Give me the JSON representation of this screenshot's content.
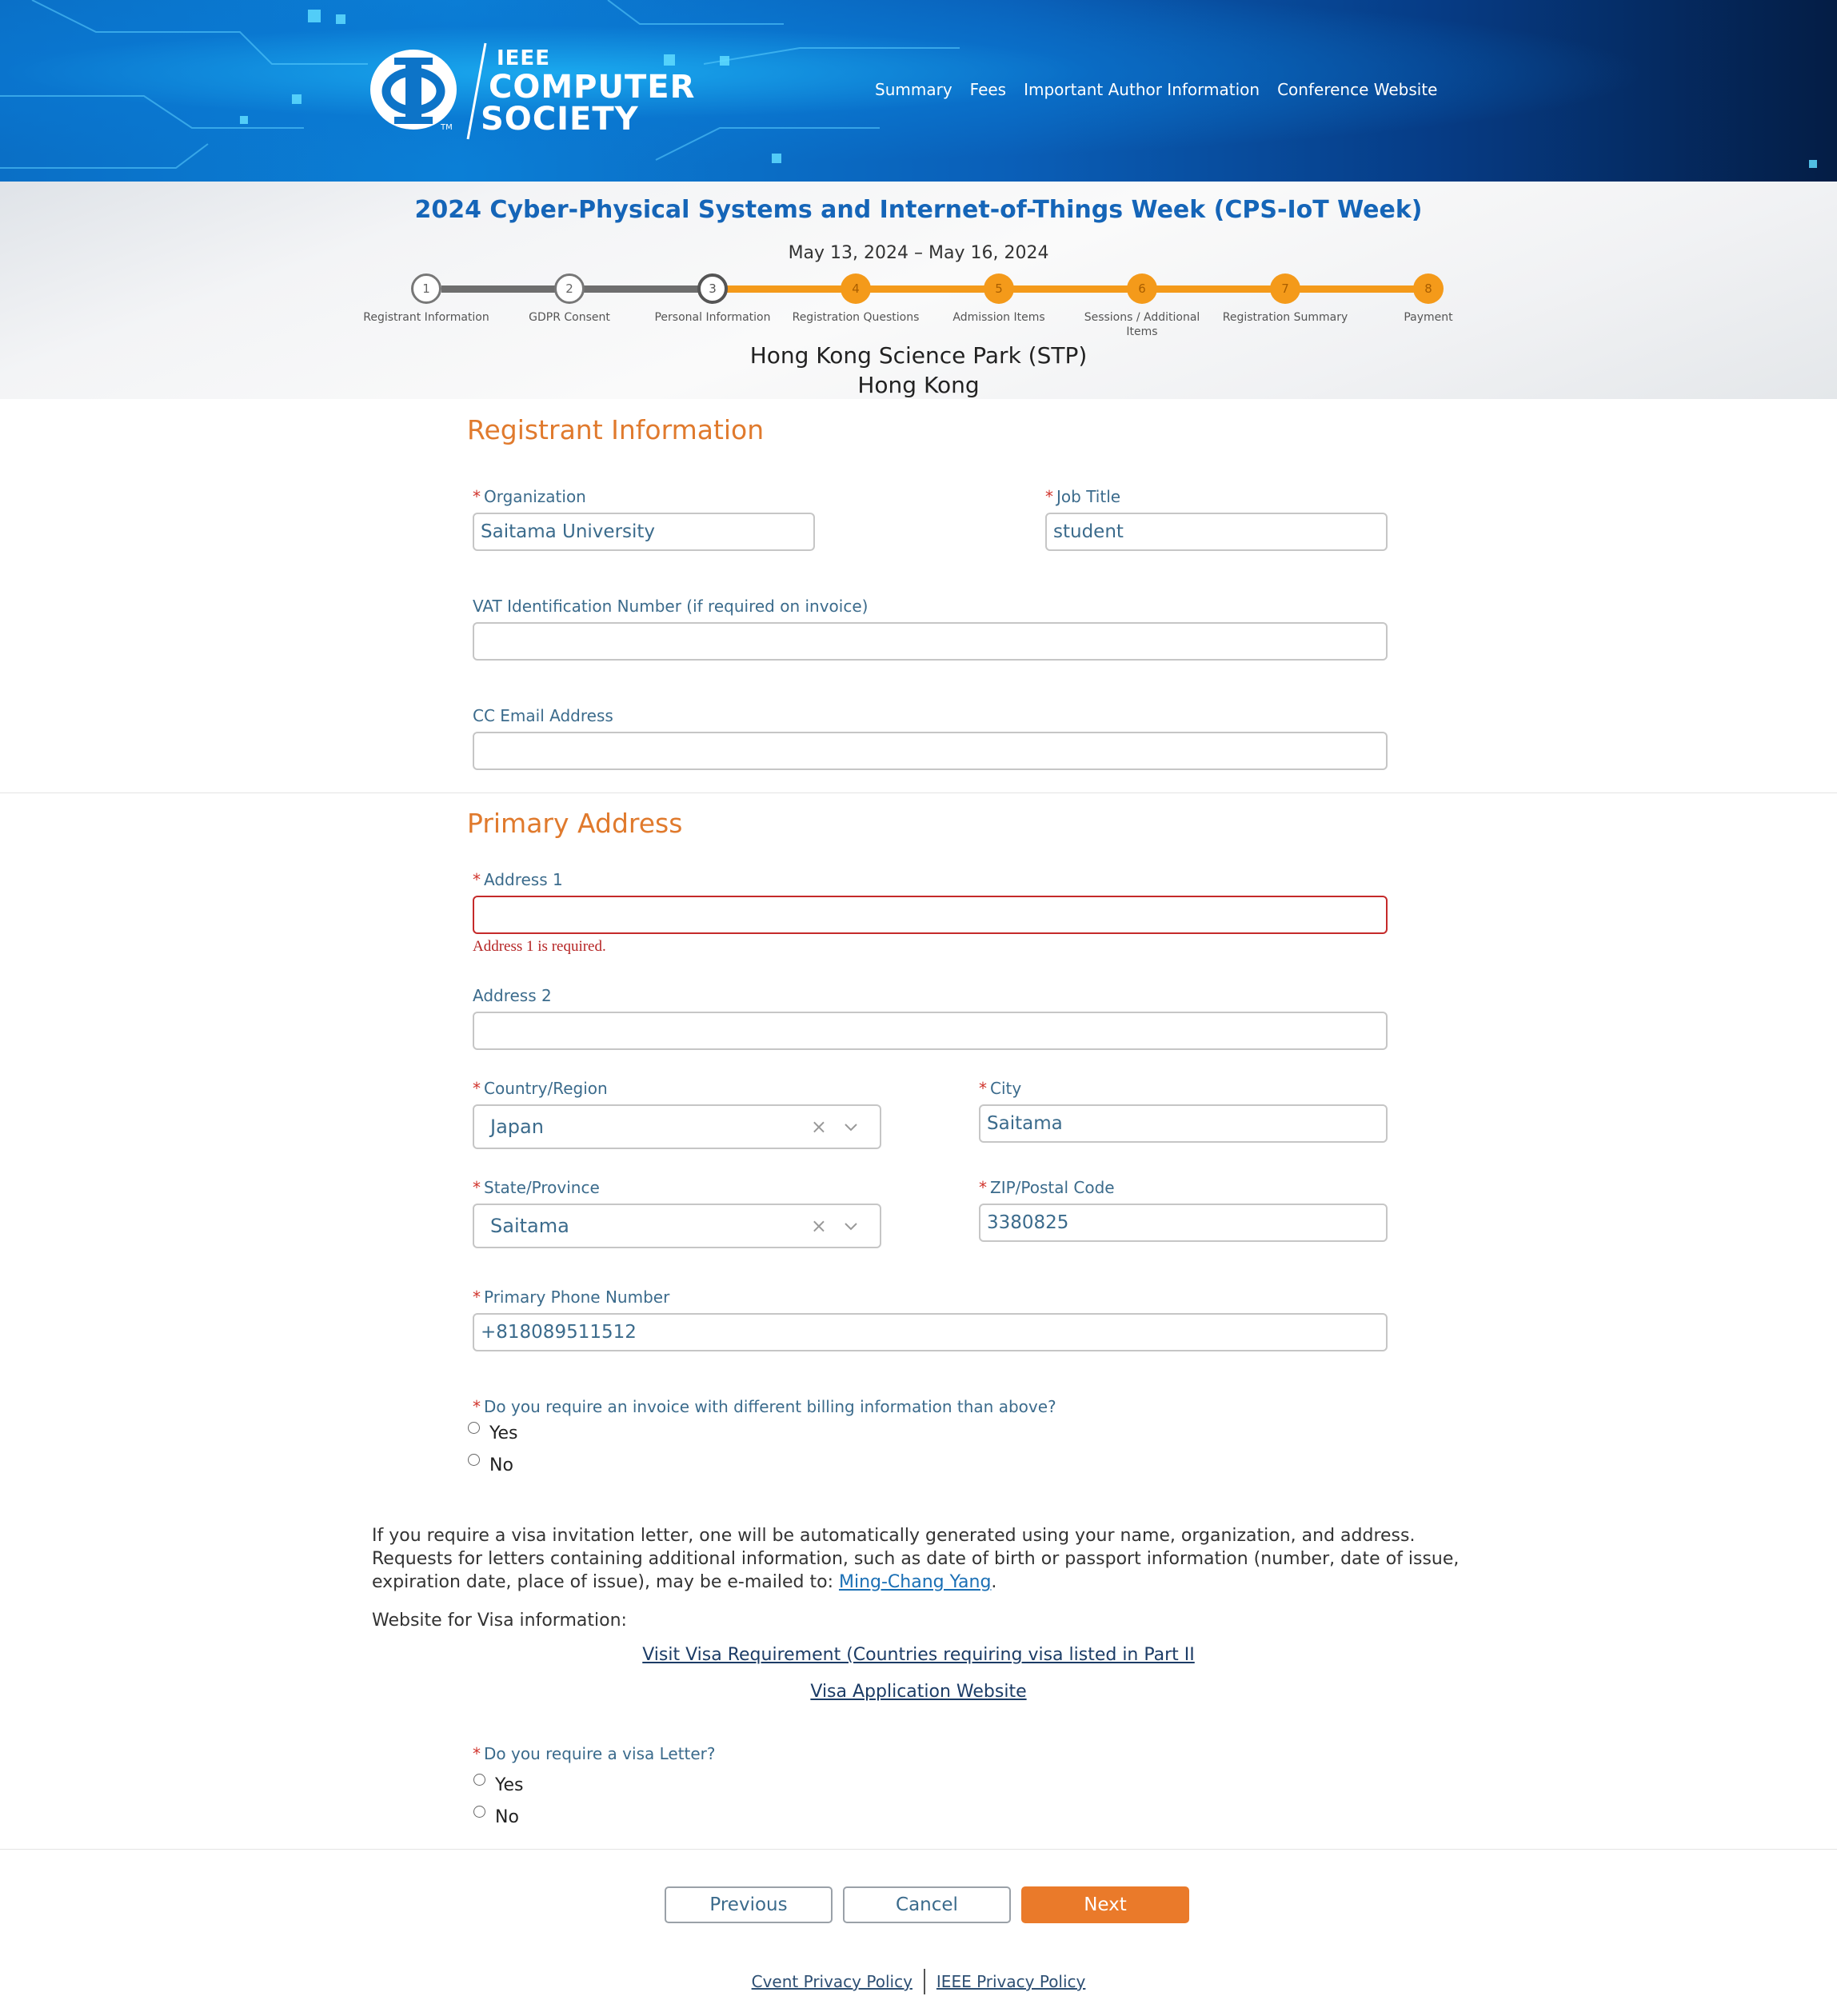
{
  "header": {
    "logo": {
      "ieee": "IEEE",
      "line1": "COMPUTER",
      "line2": "SOCIETY",
      "tm": "TM"
    },
    "nav": [
      "Summary",
      "Fees",
      "Important Author Information",
      "Conference Website"
    ]
  },
  "event": {
    "title": "2024 Cyber-Physical Systems and Internet-of-Things Week (CPS-IoT Week)",
    "dates": "May 13, 2024 – May 16, 2024",
    "venue_line1": "Hong Kong Science Park (STP)",
    "venue_line2": "Hong Kong"
  },
  "steps": [
    {
      "num": "1",
      "label": "Registrant Information",
      "state": "done"
    },
    {
      "num": "2",
      "label": "GDPR Consent",
      "state": "done"
    },
    {
      "num": "3",
      "label": "Personal Information",
      "state": "current"
    },
    {
      "num": "4",
      "label": "Registration Questions",
      "state": "todo"
    },
    {
      "num": "5",
      "label": "Admission Items",
      "state": "todo"
    },
    {
      "num": "6",
      "label": "Sessions / Additional Items",
      "state": "todo"
    },
    {
      "num": "7",
      "label": "Registration Summary",
      "state": "todo"
    },
    {
      "num": "8",
      "label": "Payment",
      "state": "todo"
    }
  ],
  "registrant": {
    "title": "Registrant Information",
    "organization": {
      "label": "Organization",
      "value": "Saitama University"
    },
    "job_title": {
      "label": "Job Title",
      "value": "student"
    },
    "vat": {
      "label": "VAT Identification Number (if required on invoice)",
      "value": ""
    },
    "cc_email": {
      "label": "CC Email Address",
      "value": ""
    }
  },
  "address": {
    "title": "Primary Address",
    "address1": {
      "label": "Address 1",
      "value": "",
      "error": "Address 1 is required."
    },
    "address2": {
      "label": "Address 2",
      "value": ""
    },
    "country": {
      "label": "Country/Region",
      "value": "Japan"
    },
    "city": {
      "label": "City",
      "value": "Saitama"
    },
    "state": {
      "label": "State/Province",
      "value": "Saitama"
    },
    "zip": {
      "label": "ZIP/Postal Code",
      "value": "3380825"
    },
    "phone": {
      "label": "Primary Phone Number",
      "value": "+818089511512"
    },
    "billing_q": {
      "label": "Do you require an invoice with different billing information than above?",
      "options": [
        "Yes",
        "No"
      ]
    }
  },
  "visa": {
    "text_before": "If you require a visa invitation letter, one will be automatically generated using your name, organization, and address. Requests for letters containing additional information, such as date of birth or passport information (number, date of issue, expiration date, place of issue), may be e-mailed to: ",
    "contact_link": "Ming-Chang Yang",
    "text_after": ".",
    "website_label": "Website for Visa information:",
    "link1": "Visit Visa Requirement (Countries requiring visa listed in Part II",
    "link2": "Visa Application Website",
    "question": "Do you require a visa Letter?",
    "options": [
      "Yes",
      "No"
    ]
  },
  "buttons": {
    "previous": "Previous",
    "cancel": "Cancel",
    "next": "Next"
  },
  "footer": {
    "cvent": "Cvent Privacy Policy",
    "ieee": "IEEE Privacy Policy"
  },
  "colors": {
    "accent": "#e07a2d",
    "step_todo": "#f49a1a",
    "link": "#1a6fb5",
    "error": "#c52a2a",
    "title_blue": "#1565b8"
  }
}
